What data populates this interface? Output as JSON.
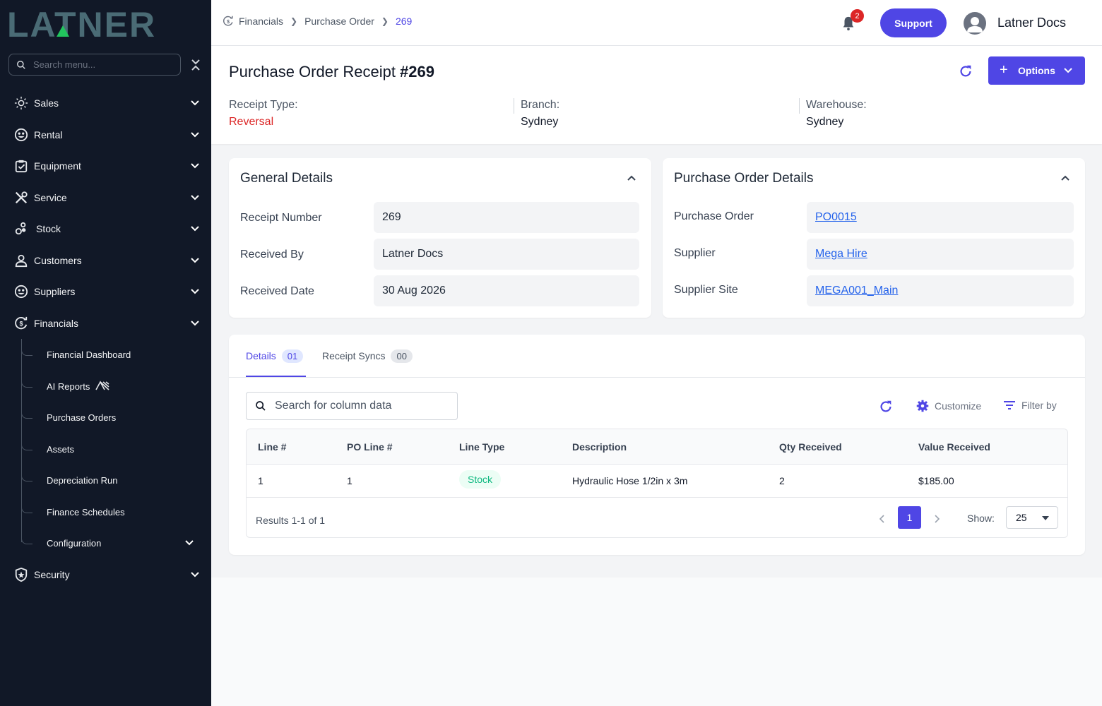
{
  "sidebar": {
    "logo_text": "LATNER",
    "search_placeholder": "Search menu...",
    "items": [
      {
        "label": "Sales"
      },
      {
        "label": "Rental"
      },
      {
        "label": "Equipment"
      },
      {
        "label": "Service"
      },
      {
        "label": "Stock"
      },
      {
        "label": "Customers"
      },
      {
        "label": "Suppliers"
      },
      {
        "label": "Financials"
      },
      {
        "label": "Security"
      }
    ],
    "financials_sub": [
      {
        "label": "Financial Dashboard"
      },
      {
        "label": "AI Reports"
      },
      {
        "label": "Purchase Orders"
      },
      {
        "label": "Assets"
      },
      {
        "label": "Depreciation Run"
      },
      {
        "label": "Finance Schedules"
      },
      {
        "label": "Configuration"
      }
    ]
  },
  "topbar": {
    "breadcrumb": [
      "Financials",
      "Purchase Order",
      "269"
    ],
    "notification_count": "2",
    "support_label": "Support",
    "user_name": "Latner Docs"
  },
  "header": {
    "title": "Purchase Order Receipt",
    "number": "#269",
    "options_label": "Options",
    "receipt_type_label": "Receipt Type:",
    "receipt_type_value": "Reversal",
    "branch_label": "Branch:",
    "branch_value": "Sydney",
    "warehouse_label": "Warehouse:",
    "warehouse_value": "Sydney"
  },
  "general": {
    "title": "General Details",
    "fields": [
      {
        "label": "Receipt Number",
        "value": "269"
      },
      {
        "label": "Received By",
        "value": "Latner Docs"
      },
      {
        "label": "Received Date",
        "value": "30 Aug 2026"
      }
    ]
  },
  "po_details": {
    "title": "Purchase Order Details",
    "fields": [
      {
        "label": "Purchase Order",
        "value": "PO0015"
      },
      {
        "label": "Supplier",
        "value": "Mega Hire"
      },
      {
        "label": "Supplier Site",
        "value": "MEGA001_Main"
      }
    ]
  },
  "tabs": [
    {
      "label": "Details",
      "count": "01"
    },
    {
      "label": "Receipt Syncs",
      "count": "00"
    }
  ],
  "table": {
    "search_placeholder": "Search for column data",
    "customize_label": "Customize",
    "filter_label": "Filter by",
    "columns": [
      "Line #",
      "PO Line #",
      "Line Type",
      "Description",
      "Qty Received",
      "Value Received"
    ],
    "rows": [
      {
        "line": "1",
        "po_line": "1",
        "line_type": "Stock",
        "description": "Hydraulic Hose 1/2in x 3m",
        "qty": "2",
        "value": "$185.00"
      }
    ],
    "results_text": "Results 1-1 of 1",
    "current_page": "1",
    "show_label": "Show:",
    "page_size": "25"
  },
  "colors": {
    "accent": "#4f46e5",
    "sidebar_bg": "#111827",
    "logo": "#4a6b75",
    "logo_accent": "#22c55e",
    "danger": "#dc2626",
    "link": "#2563eb"
  }
}
